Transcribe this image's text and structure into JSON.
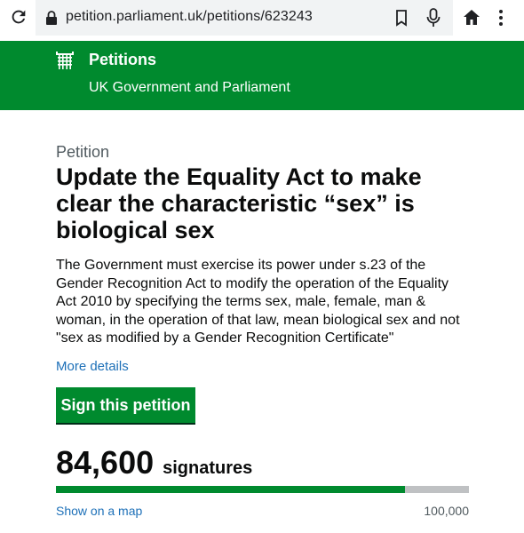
{
  "browser": {
    "url": "petition.parliament.uk/petitions/623243"
  },
  "header": {
    "brand": "Petitions",
    "subtitle": "UK Government and Parliament",
    "background_color": "#008a2e"
  },
  "petition": {
    "eyebrow": "Petition",
    "title": "Update the Equality Act to make clear the characteristic “sex” is biological sex",
    "description": "The Government must exercise its power under s.23 of the Gender Recognition Act to modify the operation of the Equality Act 2010 by specifying the terms sex, male, female, man & woman, in the operation of that law, mean biological sex and not \"sex as modified by a Gender Recognition Certificate\"",
    "more_details_label": "More details",
    "sign_button_label": "Sign this petition"
  },
  "signatures": {
    "count": "84,600",
    "label": "signatures",
    "target": "100,000",
    "progress_fraction": 0.846,
    "map_link_label": "Show on a map"
  }
}
